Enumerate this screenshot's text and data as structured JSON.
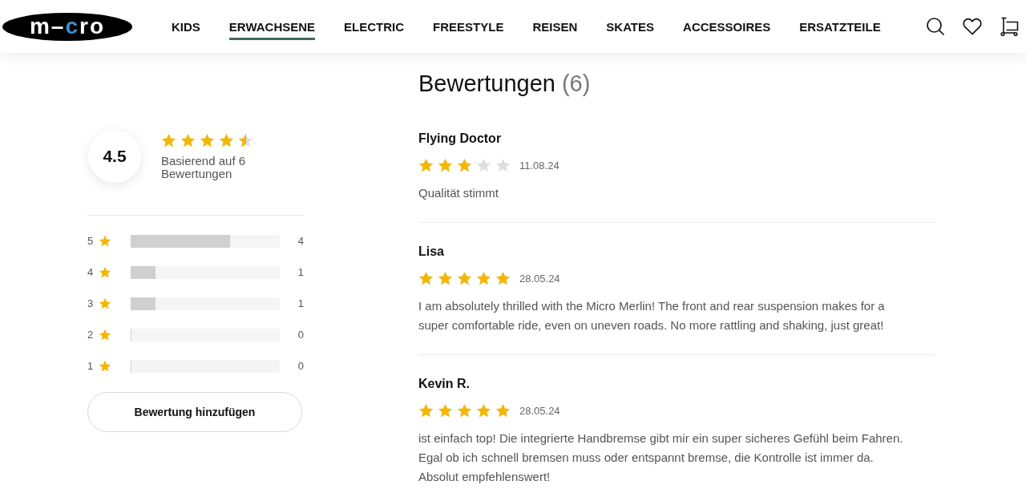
{
  "header": {
    "logo": "m–cro",
    "nav": [
      {
        "label": "KIDS",
        "selected": false
      },
      {
        "label": "ERWACHSENE",
        "selected": true
      },
      {
        "label": "ELECTRIC",
        "selected": false
      },
      {
        "label": "FREESTYLE",
        "selected": false
      },
      {
        "label": "REISEN",
        "selected": false
      },
      {
        "label": "SKATES",
        "selected": false
      },
      {
        "label": "ACCESSOIRES",
        "selected": false
      },
      {
        "label": "ERSATZTEILE",
        "selected": false
      }
    ]
  },
  "summary": {
    "average": "4.5",
    "stars": 4.5,
    "basis": "Basierend auf 6 Bewertungen",
    "histogram": [
      {
        "rating": "5",
        "level": 0.667,
        "count": "4"
      },
      {
        "rating": "4",
        "level": 0.167,
        "count": "1"
      },
      {
        "rating": "3",
        "level": 0.167,
        "count": "1"
      },
      {
        "rating": "2",
        "level": 0,
        "count": "0"
      },
      {
        "rating": "1",
        "level": 0,
        "count": "0"
      }
    ],
    "add_button": "Bewertung hinzufügen"
  },
  "reviews": {
    "title": "Bewertungen",
    "count": "(6)",
    "items": [
      {
        "author": "Flying Doctor",
        "stars": 3,
        "date": "11.08.24",
        "text": "Qualität stimmt"
      },
      {
        "author": "Lisa",
        "stars": 5,
        "date": "28.05.24",
        "text": "I am absolutely thrilled with the Micro Merlin! The front and rear suspension makes for a super comfortable ride, even on uneven roads. No more rattling and shaking, just great!"
      },
      {
        "author": "Kevin R.",
        "stars": 5,
        "date": "28.05.24",
        "text": "ist einfach top! Die integrierte Handbremse gibt mir ein super sicheres Gefühl beim Fahren. Egal ob ich schnell bremsen muss oder entspannt bremse, die Kontrolle ist immer da. Absolut empfehlenswert!"
      }
    ]
  }
}
